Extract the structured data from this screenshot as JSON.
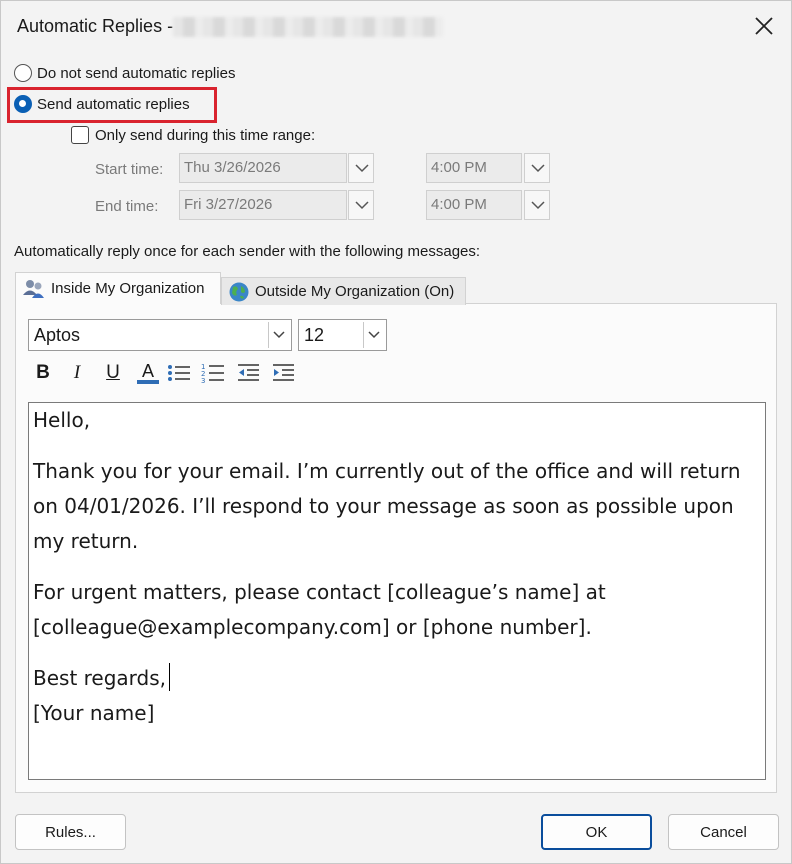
{
  "window": {
    "title": "Automatic Replies - "
  },
  "options": {
    "do_not_send_label": "Do not send automatic replies",
    "send_label": "Send automatic replies",
    "time_range_label": "Only send during this time range:"
  },
  "time_range": {
    "start_label": "Start time:",
    "start_date": "Thu 3/26/2026",
    "start_time": "4:00 PM",
    "end_label": "End time:",
    "end_date": "Fri 3/27/2026",
    "end_time": "4:00 PM"
  },
  "instructions": "Automatically reply once for each sender with the following messages:",
  "tabs": [
    {
      "label": "Inside My Organization",
      "active": true,
      "icon": "people-icon"
    },
    {
      "label": "Outside My Organization (On)",
      "active": false,
      "icon": "globe-icon"
    }
  ],
  "formatting": {
    "font": "Aptos",
    "size": "12",
    "bold": "B",
    "italic": "I",
    "underline": "U",
    "font_color": "A",
    "font_color_hex": "#2f6db5"
  },
  "message": {
    "greeting": "Hello,",
    "para1_line1": "Thank you for your email. I’m currently out of the office and will return",
    "para1_line2": "on 04/01/2026. I’ll respond to your message as soon as possible upon",
    "para1_line3": "my return.",
    "para2_line1": "For urgent matters, please contact [colleague’s name] at",
    "para2_line2": "[colleague@examplecompany.com] or [phone number].",
    "closing": "Best regards,",
    "signature": "[Your name]"
  },
  "buttons": {
    "rules": "Rules...",
    "ok": "OK",
    "cancel": "Cancel"
  },
  "colors": {
    "accent": "#0a5fb4",
    "highlight": "#d9232e"
  }
}
